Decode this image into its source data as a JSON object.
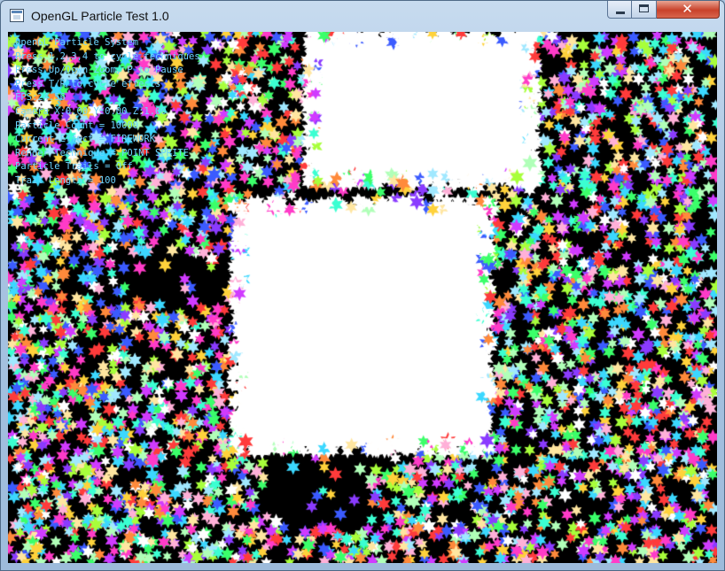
{
  "window": {
    "title": "OpenGL Particle Test 1.0",
    "icon": "app-window-icon",
    "controls": {
      "minimize": "minimize-icon",
      "maximize": "maximize-icon",
      "close": "close-icon",
      "close_glyph": "✕"
    }
  },
  "scene": {
    "background": "#000000",
    "particle_shape": "six-point-star",
    "particle_colors": [
      "#ff3b3b",
      "#ffd23b",
      "#3bff6a",
      "#3bd8ff",
      "#3b5bff",
      "#d03bff",
      "#ff3bc8",
      "#ffffff",
      "#ff8a3b",
      "#a8ff3b",
      "#3bffd2",
      "#8a3bff",
      "#ffe6a0",
      "#b0ffb8",
      "#ffb0d8",
      "#a0e8ff"
    ],
    "overlay_color": "#6cd4ff",
    "overlay_lines": [
      "OpenGL Particle System",
      "Press 1,2,3,4 to cycle techniques",
      "Press Up/Down Zoom, P to Pause",
      "Press T/R to cycle effects",
      "FPS:24.56",
      "Camera X:0.00 Y:0.00 Z:1.00",
      "Particle Count = 10000",
      "Current Effect = FIREWORK",
      "Render Technique = POINT SPRITE",
      "Particle Trails = Off",
      "Trail Length = 100"
    ]
  }
}
